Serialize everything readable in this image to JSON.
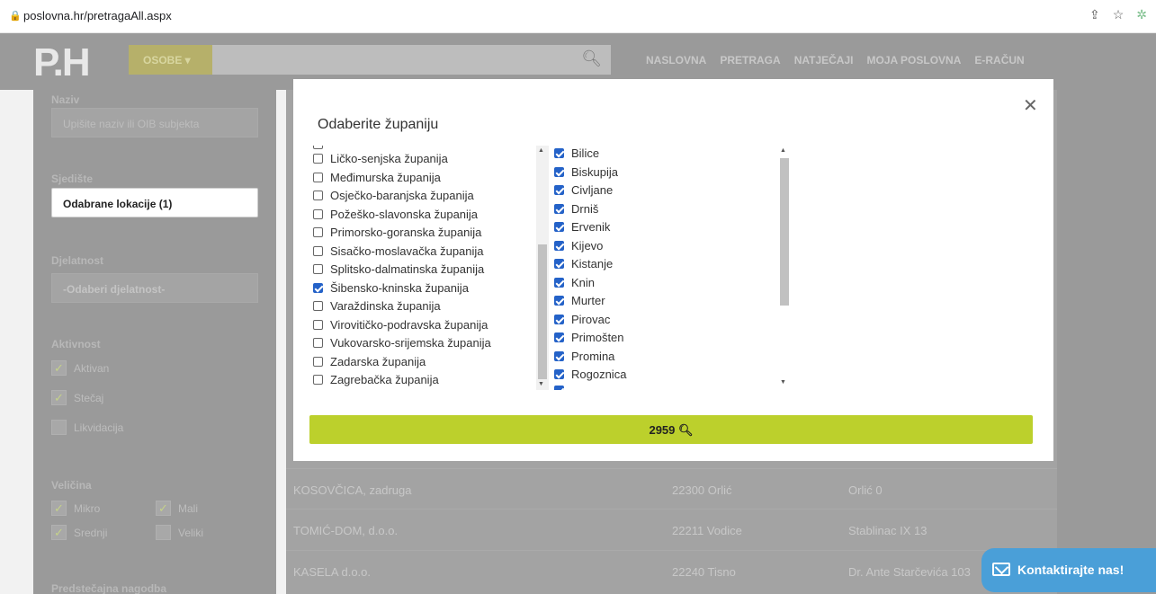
{
  "browser": {
    "url": "poslovna.hr/pretragaAll.aspx"
  },
  "header": {
    "logo": "P.H",
    "category": "OSOBE",
    "nav": [
      "NASLOVNA",
      "PRETRAGA",
      "NATJEČAJI",
      "MOJA POSLOVNA",
      "E-RAČUN"
    ]
  },
  "sidebar": {
    "naziv_label": "Naziv",
    "naziv_placeholder": "Upišite naziv ili OIB subjekta",
    "sjediste_label": "Sjedište",
    "sjediste_value": "Odabrane lokacije (1)",
    "djelatnost_label": "Djelatnost",
    "djelatnost_value": "-Odaberi djelatnost-",
    "aktivnost_label": "Aktivnost",
    "aktivnost_items": [
      {
        "label": "Aktivan",
        "checked": true
      },
      {
        "label": "Stečaj",
        "checked": true
      },
      {
        "label": "Likvidacija",
        "checked": false
      }
    ],
    "velicina_label": "Veličina",
    "velicina_items": [
      {
        "label": "Mikro",
        "checked": true
      },
      {
        "label": "Mali",
        "checked": true
      },
      {
        "label": "Srednji",
        "checked": true
      },
      {
        "label": "Veliki",
        "checked": false
      }
    ],
    "predstecajna_label": "Predstečajna nagodba"
  },
  "results": [
    {
      "name": "KOSOVČICA, zadruga",
      "post": "22300 Orlić",
      "address": "Orlić 0"
    },
    {
      "name": "TOMIĆ-DOM, d.o.o.",
      "post": "22211 Vodice",
      "address": "Stablinac IX 13"
    },
    {
      "name": "KASELA d.o.o.",
      "post": "22240 Tisno",
      "address": "Dr. Ante Starčevića 103"
    }
  ],
  "modal": {
    "title": "Odaberite županiju",
    "counties": [
      {
        "label": "Ličko-senjska županija",
        "checked": false
      },
      {
        "label": "Međimurska županija",
        "checked": false
      },
      {
        "label": "Osječko-baranjska županija",
        "checked": false
      },
      {
        "label": "Požeško-slavonska županija",
        "checked": false
      },
      {
        "label": "Primorsko-goranska županija",
        "checked": false
      },
      {
        "label": "Sisačko-moslavačka županija",
        "checked": false
      },
      {
        "label": "Splitsko-dalmatinska županija",
        "checked": false
      },
      {
        "label": "Šibensko-kninska županija",
        "checked": true
      },
      {
        "label": "Varaždinska županija",
        "checked": false
      },
      {
        "label": "Virovitičko-podravska županija",
        "checked": false
      },
      {
        "label": "Vukovarsko-srijemska županija",
        "checked": false
      },
      {
        "label": "Zadarska županija",
        "checked": false
      },
      {
        "label": "Zagrebačka županija",
        "checked": false
      }
    ],
    "cities": [
      {
        "label": "Bilice",
        "checked": true
      },
      {
        "label": "Biskupija",
        "checked": true
      },
      {
        "label": "Civljane",
        "checked": true
      },
      {
        "label": "Drniš",
        "checked": true
      },
      {
        "label": "Ervenik",
        "checked": true
      },
      {
        "label": "Kijevo",
        "checked": true
      },
      {
        "label": "Kistanje",
        "checked": true
      },
      {
        "label": "Knin",
        "checked": true
      },
      {
        "label": "Murter",
        "checked": true
      },
      {
        "label": "Pirovac",
        "checked": true
      },
      {
        "label": "Primošten",
        "checked": true
      },
      {
        "label": "Promina",
        "checked": true
      },
      {
        "label": "Rogoznica",
        "checked": true
      }
    ],
    "search_count": "2959"
  },
  "contact_label": "Kontaktirajte nas!",
  "colors": {
    "accent_green": "#bcd02c",
    "checkbox_blue": "#2462c8",
    "contact_blue": "#4a9fd8"
  }
}
